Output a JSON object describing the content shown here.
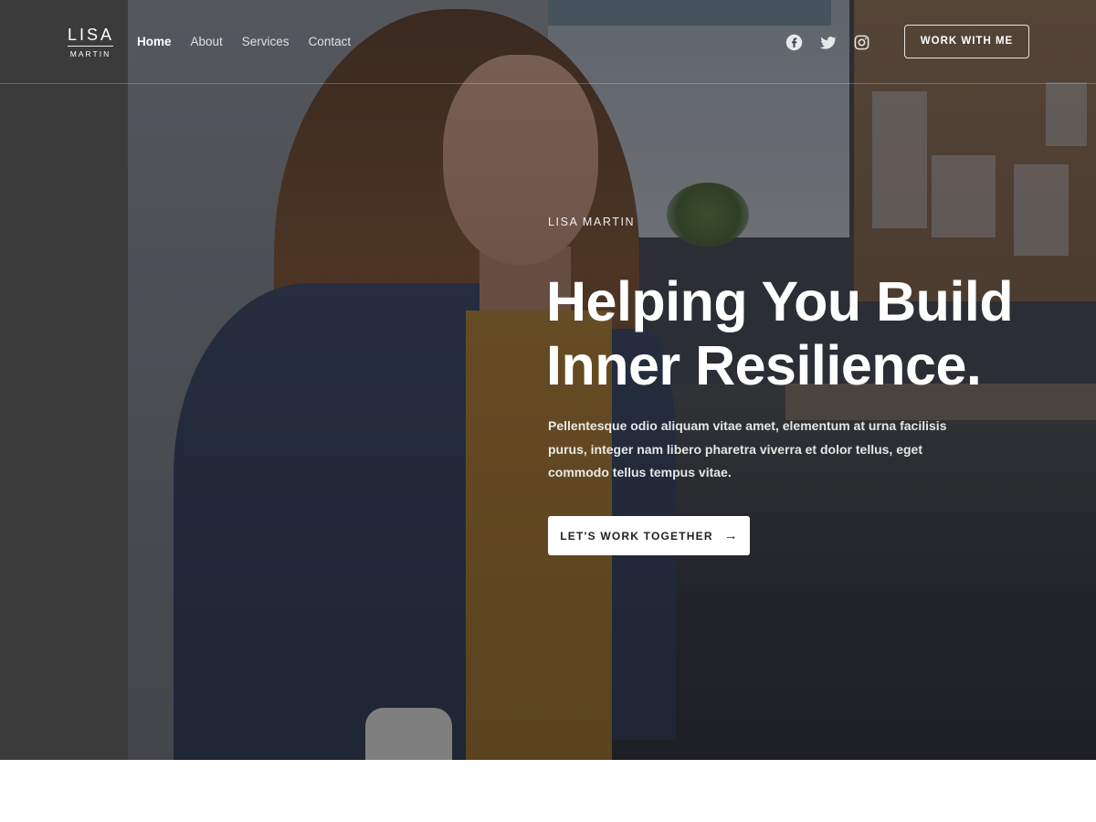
{
  "brand": {
    "name_top": "LISA",
    "name_bottom": "MARTIN"
  },
  "nav": {
    "items": [
      {
        "label": "Home",
        "active": true
      },
      {
        "label": "About",
        "active": false
      },
      {
        "label": "Services",
        "active": false
      },
      {
        "label": "Contact",
        "active": false
      }
    ]
  },
  "social": {
    "icons": [
      "facebook-icon",
      "twitter-icon",
      "instagram-icon"
    ]
  },
  "header_cta": {
    "label": "WORK WITH ME"
  },
  "hero": {
    "eyebrow": "LISA MARTIN",
    "headline_line1": "Helping You Build",
    "headline_line2": "Inner Resilience.",
    "body": "Pellentesque odio aliquam vitae amet, elementum at urna facilisis purus, integer nam libero pharetra viverra et dolor tellus, eget commodo tellus tempus vitae.",
    "cta_label": "LET'S WORK TOGETHER",
    "cta_icon": "arrow-right-icon"
  },
  "colors": {
    "overlay": "#14161c",
    "cta_bg": "#ffffff",
    "cta_text": "#1e2024",
    "page_bg": "#ffffff"
  }
}
